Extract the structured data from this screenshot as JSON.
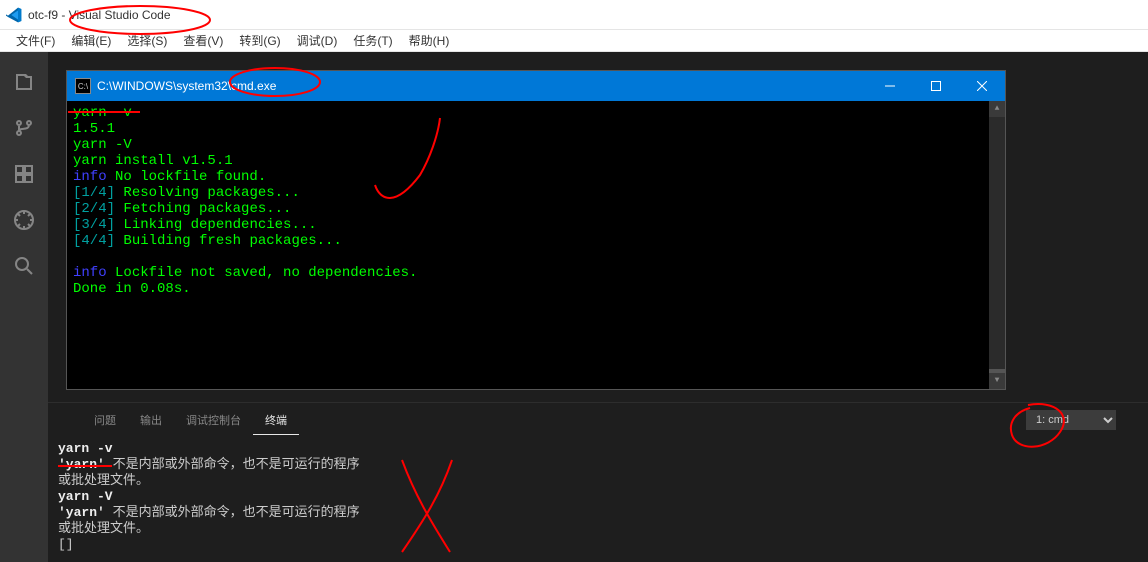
{
  "titlebar": {
    "text": "otc-f9 - Visual Studio Code"
  },
  "menu": {
    "file": "文件(F)",
    "edit": "编辑(E)",
    "selection": "选择(S)",
    "view": "查看(V)",
    "goto": "转到(G)",
    "debug": "调试(D)",
    "tasks": "任务(T)",
    "help": "帮助(H)"
  },
  "cmd": {
    "title": "C:\\WINDOWS\\system32\\cmd.exe",
    "lines": {
      "l1": "yarn -v",
      "l2": "1.5.1",
      "l3": "yarn -V",
      "l4": "yarn install v1.5.1",
      "l5a": "info",
      "l5b": " No lockfile found.",
      "l6a": "[1/4]",
      "l6b": " Resolving packages...",
      "l7a": "[2/4]",
      "l7b": " Fetching packages...",
      "l8a": "[3/4]",
      "l8b": " Linking dependencies...",
      "l9a": "[4/4]",
      "l9b": " Building fresh packages...",
      "l10a": "info",
      "l10b": " Lockfile not saved, no dependencies.",
      "l11": "Done in 0.08s."
    }
  },
  "panel": {
    "tabs": {
      "problems": "问题",
      "output": "输出",
      "debug_console": "调试控制台",
      "terminal": "终端"
    },
    "terminal_select": "1: cmd",
    "lines": {
      "t1": "yarn -v",
      "t2a": "'yarn'",
      "t2b": " 不是内部或外部命令，也不是可运行的程序",
      "t3": "或批处理文件。",
      "t4": "yarn -V",
      "t5a": "'yarn'",
      "t5b": " 不是内部或外部命令，也不是可运行的程序",
      "t6": "或批处理文件。",
      "t7": "[]"
    }
  }
}
